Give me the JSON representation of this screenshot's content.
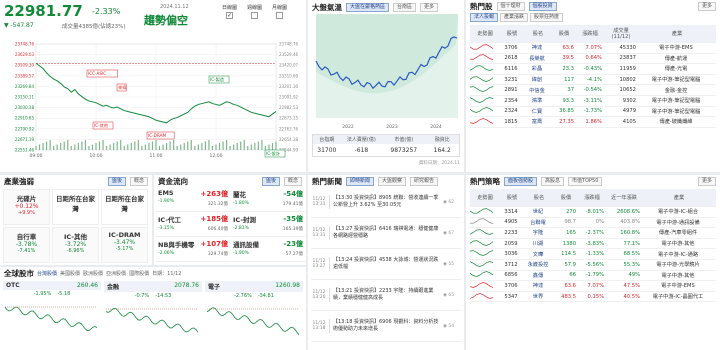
{
  "index": {
    "value": "22981.77",
    "change": "▼ -547.87",
    "pct": "-2.33%",
    "volume": "成交量4385億(佔總23%)",
    "date": "2024.11.12",
    "trend_label": "趨勢偏空"
  },
  "periods": [
    {
      "label": "日線圖",
      "checked": true
    },
    {
      "label": "週線圖",
      "checked": false
    },
    {
      "label": "月線圖",
      "checked": false
    }
  ],
  "main_chart": {
    "yticks": [
      "23748.76",
      "23629.03",
      "23509.30",
      "23389.57",
      "23269.84",
      "23150.11",
      "23030.38",
      "22910.65",
      "22790.92",
      "22671.19",
      "22551.46"
    ],
    "xticks": [
      "09:00",
      "10:00",
      "11:00",
      "12:00",
      "13:00"
    ],
    "ylabels_right": [
      "23748.76",
      "23529.46",
      "23420.07",
      "23310.69",
      "23201.30",
      "23091.92",
      "22982.53",
      "22873.15",
      "22763.76",
      "22654.38",
      "22544.99"
    ],
    "annotations": [
      "ICC-ASIC",
      "季線",
      "IC-其他",
      "IC-DRAM",
      "IC-製造",
      "IC-設計"
    ],
    "points": [
      23530,
      23500,
      23470,
      23420,
      23380,
      23350,
      23330,
      23300,
      23260,
      23240,
      23200,
      23230,
      23180,
      23150,
      23120,
      23100,
      23090,
      23080,
      23060,
      23040,
      23050,
      23030,
      23020,
      23030,
      23010,
      22990,
      22980,
      22970,
      22960,
      22950,
      22940,
      22930,
      22920,
      22900,
      22880,
      22870,
      22860,
      22850,
      22880,
      22900,
      22910,
      22930,
      22950,
      22970,
      23010,
      23040,
      23060,
      23070,
      23080,
      23090,
      23070,
      23060,
      23050,
      23070,
      23090,
      23080,
      23060,
      23050,
      23030,
      23010,
      22990,
      22970,
      22960,
      22950,
      22940,
      22930,
      22920,
      22950,
      22980
    ]
  },
  "mood": {
    "title": "大盤氣溫",
    "tabs": [
      "大盤在嚴格熱區",
      "台南區",
      "更多"
    ],
    "xticks": [
      "2022",
      "2023",
      "2024"
    ],
    "cols": [
      "台指期",
      "法人賣壓(億)",
      "市值(億)",
      "融資比"
    ],
    "vals": [
      "31700",
      "-618",
      "9873257",
      "164.2"
    ],
    "note": "資料日期：2024.11"
  },
  "hot_stocks": {
    "title": "熱門股",
    "tabs": [
      "個十理財",
      "個股投資"
    ],
    "subtabs": [
      "法人投報",
      "產業漲跌",
      "股票狂熱度"
    ],
    "more": "更多",
    "cols": [
      "走勢圖",
      "股號",
      "股名",
      "股價",
      "漲跌幅",
      "成交量(11/12)",
      "產業"
    ],
    "rows": [
      [
        "3706",
        "神達",
        "63.6",
        "7.07%",
        "45330",
        "電子中游-EMS",
        "red"
      ],
      [
        "2618",
        "長榮航",
        "39.5",
        "0.64%",
        "23837",
        "傳產-航運",
        "red"
      ],
      [
        "6116",
        "彩晶",
        "23.3",
        "-0.43%",
        "11959",
        "傳產-光電",
        "green"
      ],
      [
        "3231",
        "緯創",
        "117",
        "-4.1%",
        "10802",
        "電子中游-筆記型電腦",
        "green"
      ],
      [
        "2891",
        "中信金",
        "37",
        "-0.54%",
        "10652",
        "金融-金控",
        "green"
      ],
      [
        "2354",
        "鴻準",
        "93.3",
        "-3.11%",
        "9302",
        "電子中游-筆記型電腦",
        "green"
      ],
      [
        "2324",
        "仁寶",
        "36.85",
        "-1.73%",
        "4979",
        "電子中游-筆記型電腦",
        "green"
      ],
      [
        "1815",
        "富喬",
        "27.35",
        "1.86%",
        "4105",
        "傳產-玻纖纖維",
        "red"
      ]
    ]
  },
  "industry": {
    "title": "產業強弱",
    "tabs": [
      "盤後",
      "概念"
    ],
    "cards": [
      {
        "name": "光碟片",
        "pct": "+0.12%",
        "sub": "+9.9%",
        "color": "red"
      },
      {
        "name": "日距所在台家灣",
        "pct": "",
        "sub": "",
        "color": "gray"
      },
      {
        "name": "日距所在台家灣",
        "pct": "",
        "sub": "",
        "color": "gray"
      },
      {
        "name": "自行車",
        "pct": "-3.78%",
        "sub": "-7.41%",
        "color": "green"
      },
      {
        "name": "IC-其他",
        "pct": "-3.72%",
        "sub": "-6.96%",
        "color": "green"
      },
      {
        "name": "IC-DRAM",
        "pct": "-3.47%",
        "sub": "-5.17%",
        "color": "green"
      }
    ]
  },
  "flow": {
    "title": "資金流向",
    "tabs": [
      "盤後",
      "概念"
    ],
    "items": [
      {
        "name": "EMS",
        "val": "+263億",
        "a": "-1.90%",
        "b": "321.32億",
        "color": "red"
      },
      {
        "name": "蘭花",
        "val": "-54億",
        "a": "-1.80%",
        "b": "179.41億",
        "color": "green"
      },
      {
        "name": "IC-代工",
        "val": "+185億",
        "a": "-3.15%",
        "b": "606.40億",
        "color": "red"
      },
      {
        "name": "IC-封測",
        "val": "-35億",
        "a": "-2.81%",
        "b": "165.39億",
        "color": "green"
      },
      {
        "name": "NB與手機零",
        "val": "+107億",
        "a": "-2.06%",
        "b": "329.74億",
        "color": "red"
      },
      {
        "name": "通訊設備",
        "val": "-23億",
        "a": "-1.90%",
        "b": "57.27億",
        "color": "green"
      }
    ]
  },
  "global": {
    "title": "全球股市",
    "tabs": [
      "台灣股價",
      "美國股價",
      "歐洲股價",
      "亞洲股價",
      "國際股價"
    ],
    "date": "日期：11/12",
    "cards": [
      {
        "name": "OTC",
        "val": "260.46",
        "chg": "-1.95%",
        "pct": "-5.18",
        "color": "green"
      },
      {
        "name": "金融",
        "val": "2078.76",
        "chg": "-0.7%",
        "pct": "-14.53",
        "color": "green"
      },
      {
        "name": "電子",
        "val": "1260.98",
        "chg": "-2.76%",
        "pct": "-34.81",
        "color": "green"
      }
    ]
  },
  "news": {
    "title": "熱門新聞",
    "tabs": [
      "即時新聞",
      "大盤觀察",
      "研究報告"
    ],
    "items": [
      {
        "date": "11/12",
        "time": "13:31",
        "text": "【13:30 投資快訊】8905 統聯：營收連續一季公新營上升 3.62% 至30.05元",
        "views": "62"
      },
      {
        "date": "11/12",
        "time": "13:31",
        "text": "【13:27 投資快訊】6416 瑞祺電通：穩健健康各網路經營穩路",
        "views": "67"
      },
      {
        "date": "11/12",
        "time": "13:27",
        "text": "【13:24 投資快訊】4538 大詠城：營運狀況跌逾低檔",
        "views": "55"
      },
      {
        "date": "11/12",
        "time": "13:20",
        "text": "【13:21 投資快訊】2233 宇隆：持續跟進業績，業績穩健健高成長",
        "views": "65"
      },
      {
        "date": "11/12",
        "time": "13:18",
        "text": "【13:18 投資快訊】6906 現觀科：資料分析技術優勢助力未來增長",
        "views": "54"
      }
    ]
  },
  "strategy": {
    "title": "熱門策略",
    "tabs": [
      "面板強勢股",
      "高股息",
      "市值TOP50"
    ],
    "more": "更多",
    "cols": [
      "走勢圖",
      "股號",
      "股名",
      "股價",
      "漲跌幅",
      "近一年漲跌",
      "產業"
    ],
    "rows": [
      [
        "3314",
        "世紀",
        "270",
        "-8.01%",
        "2608.6%",
        "電子中游-IC-組合",
        "green"
      ],
      [
        "4905",
        "台聯電",
        "98.7",
        "0%",
        "403.8%",
        "電子中游-通訊設備",
        "gray"
      ],
      [
        "2233",
        "宇隆",
        "165",
        "-2.37%",
        "160.8%",
        "傳產-汽車零組件",
        "green"
      ],
      [
        "2059",
        "川湖",
        "1380",
        "-3.83%",
        "77.1%",
        "電子中游-其他",
        "green"
      ],
      [
        "3036",
        "文曄",
        "114.5",
        "-1.33%",
        "68.5%",
        "電子中游-IC-通路",
        "green"
      ],
      [
        "3712",
        "永崴投控",
        "57.9",
        "-5.56%",
        "55.3%",
        "電子中游-光學鏡片",
        "green"
      ],
      [
        "6856",
        "鑫傳",
        "66",
        "-1.79%",
        "49%",
        "電子中游-其他",
        "green"
      ],
      [
        "3706",
        "神達",
        "63.6",
        "7.07%",
        "47.5%",
        "電子中游-EMS",
        "red"
      ],
      [
        "5347",
        "世界",
        "483.5",
        "0.15%",
        "40.5%",
        "電子中游-IC-晶圓代工",
        "red"
      ]
    ]
  }
}
